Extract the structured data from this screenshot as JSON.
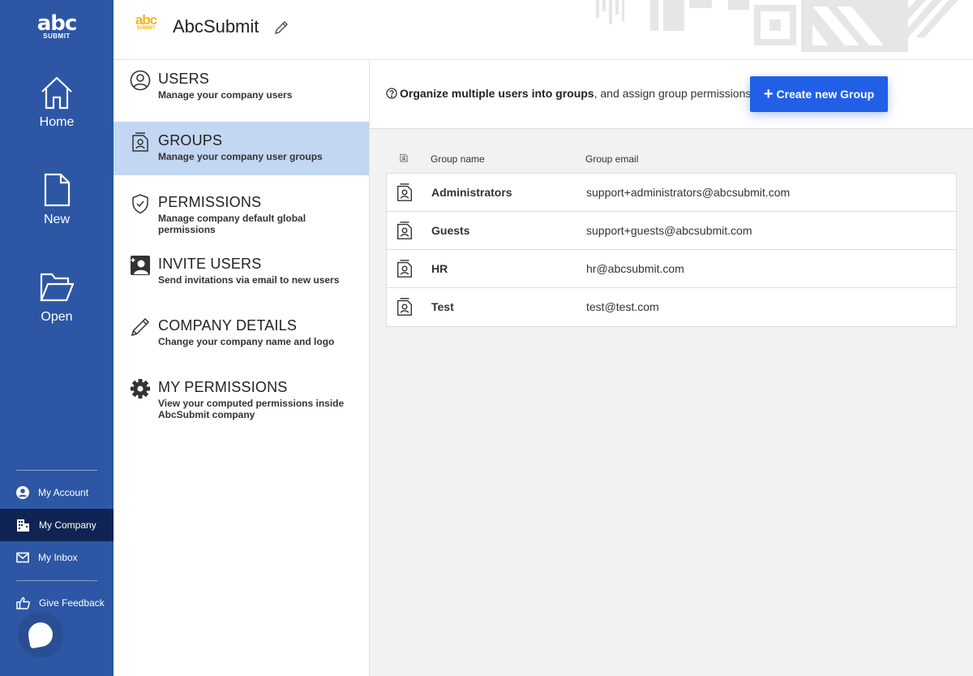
{
  "app": {
    "logo_text": "abc",
    "logo_sub": "SUBMIT",
    "company_name": "AbcSubmit"
  },
  "rail": {
    "nav": [
      {
        "label": "Home",
        "icon": "home-icon"
      },
      {
        "label": "New",
        "icon": "new-file-icon"
      },
      {
        "label": "Open",
        "icon": "folder-open-icon"
      }
    ],
    "links": [
      {
        "label": "My Account",
        "icon": "account-icon",
        "active": false
      },
      {
        "label": "My Company",
        "icon": "company-icon",
        "active": true
      },
      {
        "label": "My Inbox",
        "icon": "inbox-icon",
        "active": false
      },
      {
        "label": "Give Feedback",
        "icon": "thumbs-up-icon",
        "active": false
      }
    ]
  },
  "settings": {
    "items": [
      {
        "title": "USERS",
        "desc": "Manage your company users",
        "icon": "user-circle-icon",
        "active": false
      },
      {
        "title": "GROUPS",
        "desc": "Manage your company user groups",
        "icon": "group-contact-icon",
        "active": true
      },
      {
        "title": "PERMISSIONS",
        "desc": "Manage company default global permissions",
        "icon": "shield-check-icon",
        "active": false
      },
      {
        "title": "INVITE USERS",
        "desc": "Send invitations via email to new users",
        "icon": "invite-user-icon",
        "active": false
      },
      {
        "title": "COMPANY DETAILS",
        "desc": "Change your company name and logo",
        "icon": "pencil-icon",
        "active": false
      },
      {
        "title": "MY PERMISSIONS",
        "desc": "View your computed permissions inside AbcSubmit company",
        "icon": "gear-icon",
        "active": false
      }
    ]
  },
  "main": {
    "info_bold": "Organize multiple users into groups",
    "info_rest": ", and assign group permissions.",
    "create_button": "Create new Group",
    "columns": {
      "name": "Group name",
      "email": "Group email"
    },
    "groups": [
      {
        "name": "Administrators",
        "email": "support+administrators@abcsubmit.com"
      },
      {
        "name": "Guests",
        "email": "support+guests@abcsubmit.com"
      },
      {
        "name": "HR",
        "email": "hr@abcsubmit.com"
      },
      {
        "name": "Test",
        "email": "test@test.com"
      }
    ]
  },
  "colors": {
    "rail": "#2d57a4",
    "rail_active": "#0f2453",
    "accent_button": "#2160e6",
    "settings_active": "#c3d6f2",
    "logo_yellow": "#f3b51b"
  }
}
